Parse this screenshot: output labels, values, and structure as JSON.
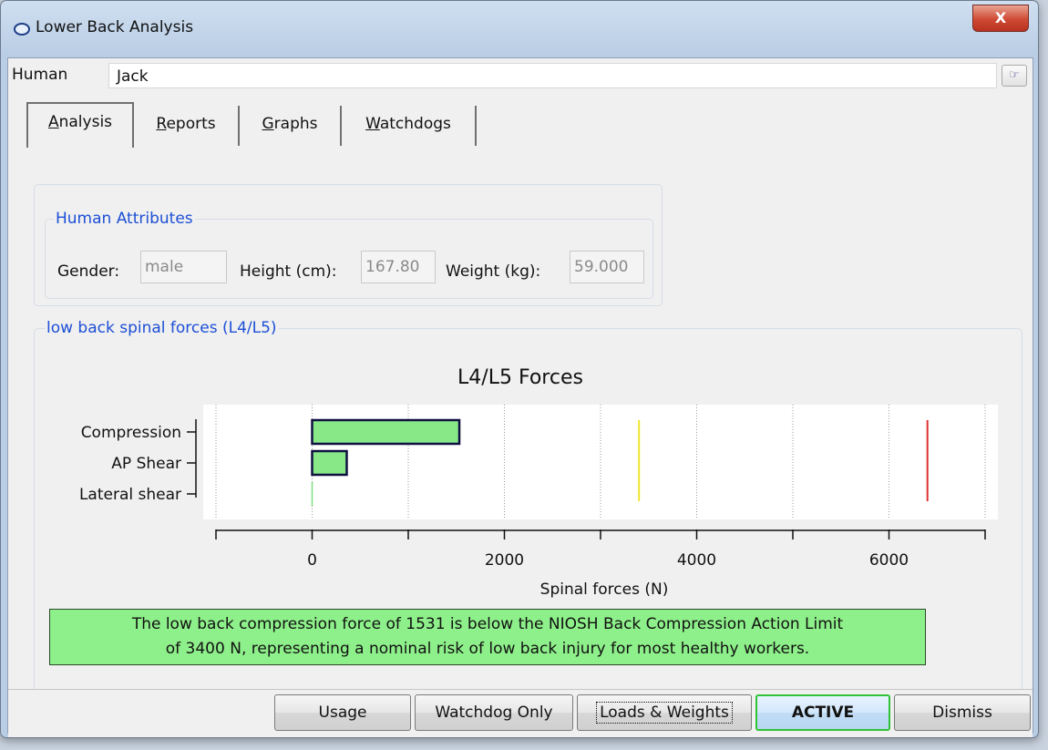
{
  "window": {
    "title": "Lower Back Analysis",
    "close_label": "X"
  },
  "human": {
    "label": "Human",
    "value": "Jack"
  },
  "tabs": [
    {
      "label": "Analysis",
      "mnemonic": "A",
      "rest": "nalysis",
      "active": true
    },
    {
      "label": "Reports",
      "mnemonic": "R",
      "rest": "eports",
      "active": false
    },
    {
      "label": "Graphs",
      "mnemonic": "G",
      "rest": "raphs",
      "active": false
    },
    {
      "label": "Watchdogs",
      "mnemonic": "W",
      "rest": "atchdogs",
      "active": false
    }
  ],
  "attributes": {
    "title": "Human Attributes",
    "gender_label": "Gender:",
    "gender_value": "male",
    "height_label": "Height (cm):",
    "height_value": "167.80",
    "weight_label": "Weight (kg):",
    "weight_value": "59.000"
  },
  "forces_group": {
    "title": "low back spinal forces (L4/L5)"
  },
  "chart_data": {
    "type": "bar",
    "orientation": "horizontal",
    "title": "L4/L5 Forces",
    "xlabel": "Spinal forces (N)",
    "ylabel": "",
    "categories": [
      "Compression",
      "AP Shear",
      "Lateral shear"
    ],
    "values": [
      1531,
      360,
      0
    ],
    "xlim": [
      -1000,
      7000
    ],
    "xticks": [
      -1000,
      0,
      1000,
      2000,
      3000,
      4000,
      5000,
      6000,
      7000
    ],
    "xtick_labels": [
      "",
      "0",
      "",
      "2000",
      "",
      "4000",
      "",
      "6000",
      ""
    ],
    "grid": "vertical-dotted",
    "bar_color": "#88e888",
    "bar_edge": "#101040",
    "reference_lines": [
      {
        "value": 3400,
        "color": "#f0e430"
      },
      {
        "value": 6400,
        "color": "#e03030"
      }
    ]
  },
  "message": {
    "line1": "The low back compression force of 1531 is below the NIOSH Back Compression Action Limit",
    "line2": "of 3400 N, representing a nominal risk of low back injury for most healthy workers.",
    "color": "#8ef08a"
  },
  "buttons": {
    "usage": "Usage",
    "watchdog_only": "Watchdog Only",
    "loads_weights": "Loads & Weights",
    "active": "ACTIVE",
    "dismiss": "Dismiss"
  }
}
